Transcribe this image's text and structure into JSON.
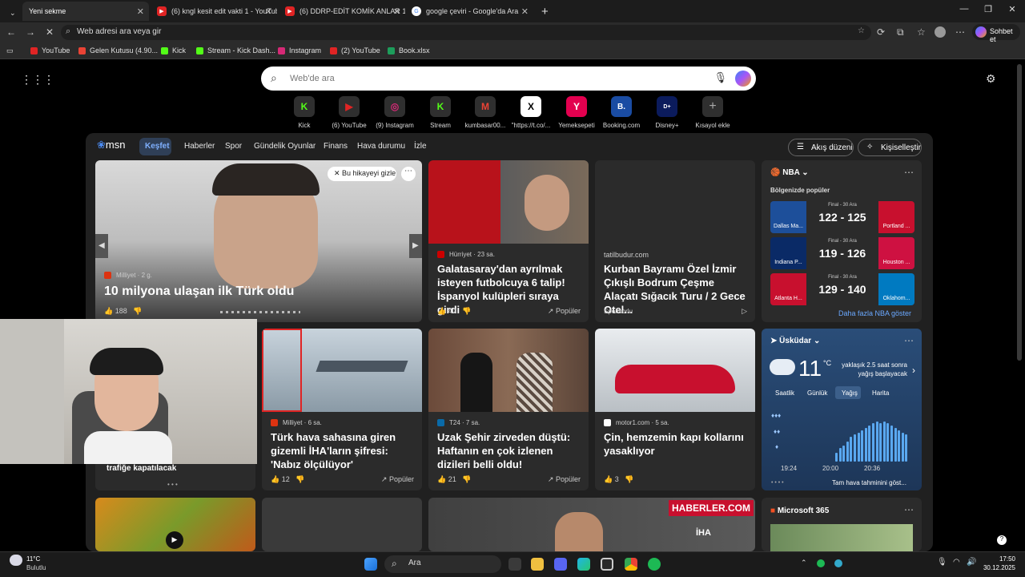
{
  "tabs": [
    {
      "label": "Yeni sekme"
    },
    {
      "label": "(6) kngl kesit edit vakti 1 - YouTub"
    },
    {
      "label": "(6) DDRP-EDİT KOMİK ANLAR 1 -"
    },
    {
      "label": "google çeviri - Google'da Ara"
    }
  ],
  "address": {
    "placeholder": "Web adresi ara veya gir"
  },
  "chat_label": "Sohbet et",
  "bookmarks": [
    "YouTube",
    "Gelen Kutusu (4.90...",
    "Kick",
    "Stream - Kick Dash...",
    "Instagram",
    "(2) YouTube",
    "Book.xlsx"
  ],
  "search": {
    "placeholder": "Web'de ara"
  },
  "quick_links": [
    "Kick",
    "(6) YouTube",
    "(9) Instagram",
    "Stream",
    "kumbasar00...",
    "\"https://t.co/...",
    "Yemeksepeti",
    "Booking.com",
    "Disney+",
    "Kısayol ekle"
  ],
  "msn": {
    "logo": "msn",
    "nav": [
      "Keşfet",
      "Haberler",
      "Spor",
      "Gündelik Oyunlar",
      "Finans",
      "Hava durumu",
      "İzle"
    ],
    "feed_layout": "Akış düzeni",
    "personalize": "Kişiselleştir"
  },
  "hero": {
    "hide": "Bu hikayeyi gizle",
    "source": "Milliyet",
    "age": "2 g.",
    "title": "10 milyona ulaşan ilk Türk oldu",
    "likes": "188"
  },
  "card_gs": {
    "source": "Hürriyet",
    "age": "23 sa.",
    "title": "Galatasaray'dan ayrılmak isteyen futbolcuya 6 talip! İspanyol kulüpleri sıraya girdi",
    "likes": "40",
    "tag": "Popüler"
  },
  "card_ad": {
    "source": "tatilbudur.com",
    "title": "Kurban Bayramı Özel İzmir Çıkışlı Bodrum Çeşme Alaçatı Sığacık Turu / 2 Gece Otel...",
    "tag": "Sponsorlu"
  },
  "nba": {
    "title": "NBA",
    "sub": "Bölgenizde popüler",
    "more": "Daha fazla NBA göster",
    "games": [
      {
        "status": "Final - 30 Ara",
        "home": "Dallas Ma...",
        "away": "Portland ...",
        "score": "122 - 125"
      },
      {
        "status": "Final - 30 Ara",
        "home": "Indiana P...",
        "away": "Houston ...",
        "score": "119 - 126"
      },
      {
        "status": "Final - 30 Ara",
        "home": "Atlanta H...",
        "away": "Oklahom...",
        "score": "129 - 140"
      }
    ]
  },
  "card_left": {
    "title_partial": "trafiğe kapatılacak"
  },
  "card_jets": {
    "source": "Milliyet",
    "age": "6 sa.",
    "title": "Türk hava sahasına giren gizemli İHA'ların şifresi: 'Nabız ölçülüyor'",
    "likes": "12",
    "tag": "Popüler"
  },
  "card_tv": {
    "source": "T24",
    "age": "7 sa.",
    "title": "Uzak Şehir zirveden düştü: Haftanın en çok izlenen dizileri belli oldu!",
    "likes": "21",
    "tag": "Popüler"
  },
  "card_car": {
    "source": "motor1.com",
    "age": "5 sa.",
    "title": "Çin, hemzemin kapı kollarını yasaklıyor",
    "likes": "3"
  },
  "weather": {
    "city": "Üsküdar",
    "temp": "11",
    "unit": "°C",
    "rain_note": "yaklaşık 2.5 saat sonra yağış başlayacak",
    "tabs": [
      "Saatlik",
      "Günlük",
      "Yağış",
      "Harita"
    ],
    "times": [
      "19:24",
      "20:00",
      "20:36"
    ],
    "full": "Tam hava tahminini göst...",
    "bars": [
      0.2,
      0.3,
      0.35,
      0.45,
      0.55,
      0.6,
      0.65,
      0.7,
      0.75,
      0.8,
      0.85,
      0.9,
      0.85,
      0.9,
      0.85,
      0.8,
      0.75,
      0.7,
      0.65,
      0.6
    ]
  },
  "m365": "Microsoft 365",
  "haberler_logo": "HABERLER.COM",
  "iha": "İHA",
  "taskbar": {
    "weather_temp": "11°C",
    "weather_desc": "Bulutlu",
    "search": "Ara",
    "time": "17:50",
    "date": "30.12.2025"
  },
  "colors": {
    "accent": "#4d8ef7",
    "panel": "#202020",
    "card": "#2b2b2b",
    "weather_bg": "#1e3a5f"
  }
}
